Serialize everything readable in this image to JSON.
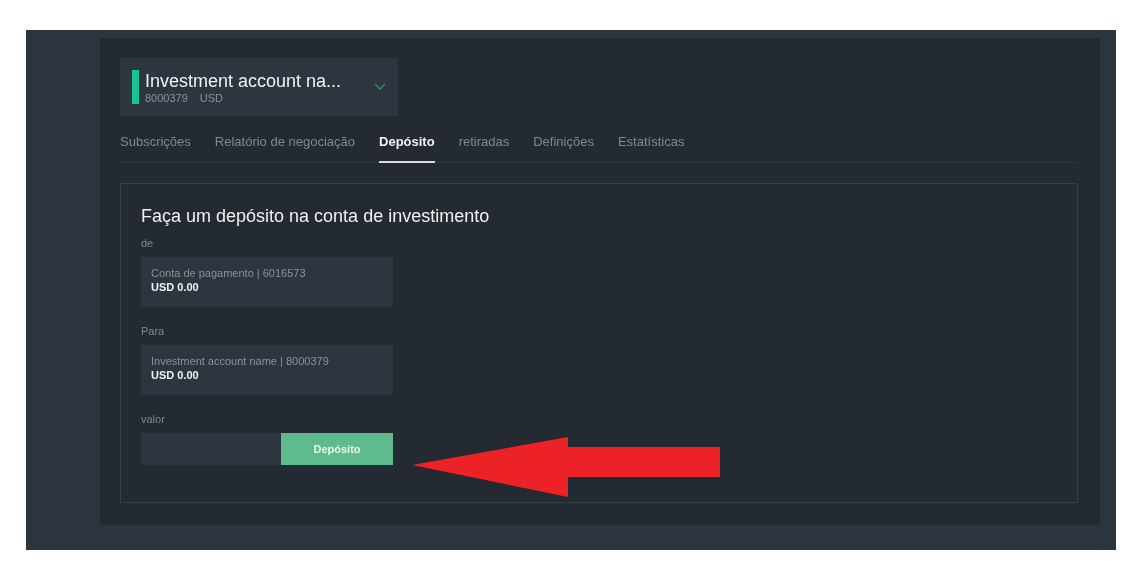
{
  "account": {
    "name": "Investment account na...",
    "number": "8000379",
    "currency": "USD"
  },
  "tabs": [
    {
      "label": "Subscrições",
      "selected": false
    },
    {
      "label": "Relatório de negociação",
      "selected": false
    },
    {
      "label": "Depósito",
      "selected": true
    },
    {
      "label": "retiradas",
      "selected": false
    },
    {
      "label": "Definições",
      "selected": false
    },
    {
      "label": "Estatísticas",
      "selected": false
    }
  ],
  "form": {
    "title": "Faça um depósito na conta de investimento",
    "from": {
      "label": "de",
      "account": "Conta de pagamento | 6016573",
      "balance": "USD 0.00"
    },
    "to": {
      "label": "Para",
      "account": "Investment account name | 8000379",
      "balance": "USD 0.00"
    },
    "amount": {
      "label": "valor",
      "button": "Depósito"
    }
  }
}
